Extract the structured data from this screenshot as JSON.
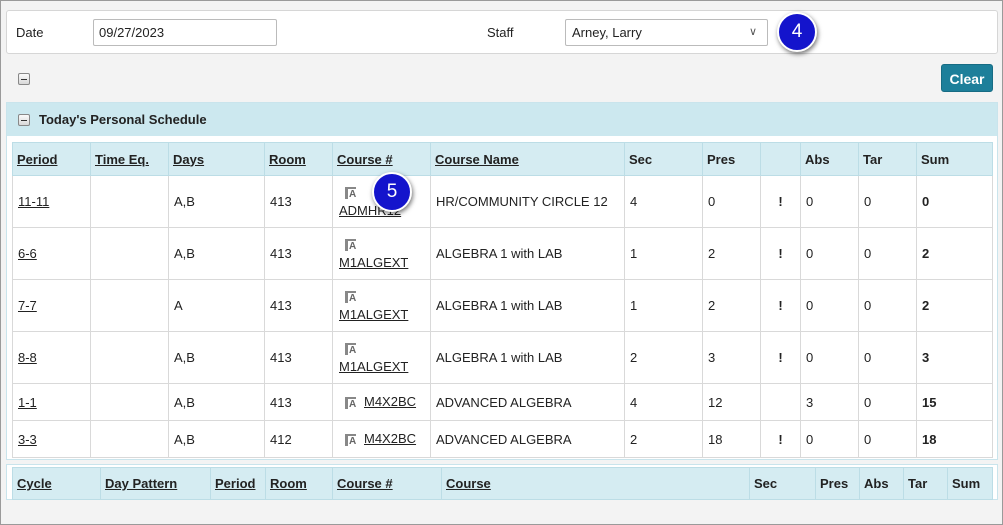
{
  "filter": {
    "date_label": "Date",
    "date_value": "09/27/2023",
    "staff_label": "Staff",
    "staff_value": "Arney, Larry"
  },
  "callouts": {
    "c4": "4",
    "c5": "5"
  },
  "clear_label": "Clear",
  "panel": {
    "title": "Today's Personal Schedule",
    "headers": [
      "Period",
      "Time Eq.",
      "Days",
      "Room",
      "Course #",
      "Course Name",
      "Sec",
      "Pres",
      "",
      "Abs",
      "Tar",
      "Sum"
    ],
    "rows": [
      {
        "period": "11-11",
        "time_eq": "",
        "days": "A,B",
        "room": "413",
        "course": "ADMHR12",
        "course_name": "HR/COMMUNITY CIRCLE 12",
        "sec": "4",
        "pres": "0",
        "alert": "!",
        "abs": "0",
        "tar": "0",
        "sum": "0"
      },
      {
        "period": "6-6",
        "time_eq": "",
        "days": "A,B",
        "room": "413",
        "course": "M1ALGEXT",
        "course_name": "ALGEBRA 1 with LAB",
        "sec": "1",
        "pres": "2",
        "alert": "!",
        "abs": "0",
        "tar": "0",
        "sum": "2"
      },
      {
        "period": "7-7",
        "time_eq": "",
        "days": "A",
        "room": "413",
        "course": "M1ALGEXT",
        "course_name": "ALGEBRA 1 with LAB",
        "sec": "1",
        "pres": "2",
        "alert": "!",
        "abs": "0",
        "tar": "0",
        "sum": "2"
      },
      {
        "period": "8-8",
        "time_eq": "",
        "days": "A,B",
        "room": "413",
        "course": "M1ALGEXT",
        "course_name": "ALGEBRA 1 with LAB",
        "sec": "2",
        "pres": "3",
        "alert": "!",
        "abs": "0",
        "tar": "0",
        "sum": "3"
      },
      {
        "period": "1-1",
        "time_eq": "",
        "days": "A,B",
        "room": "413",
        "course": "M4X2BC",
        "course_name": "ADVANCED ALGEBRA",
        "sec": "4",
        "pres": "12",
        "alert": "",
        "abs": "3",
        "tar": "0",
        "sum": "15"
      },
      {
        "period": "3-3",
        "time_eq": "",
        "days": "A,B",
        "room": "412",
        "course": "M4X2BC",
        "course_name": "ADVANCED ALGEBRA",
        "sec": "2",
        "pres": "18",
        "alert": "!",
        "abs": "0",
        "tar": "0",
        "sum": "18"
      }
    ]
  },
  "bottom": {
    "headers": [
      "Cycle",
      "Day Pattern",
      "Period",
      "Room",
      "Course #",
      "Course",
      "Sec",
      "Pres",
      "Abs",
      "Tar",
      "Sum"
    ]
  }
}
